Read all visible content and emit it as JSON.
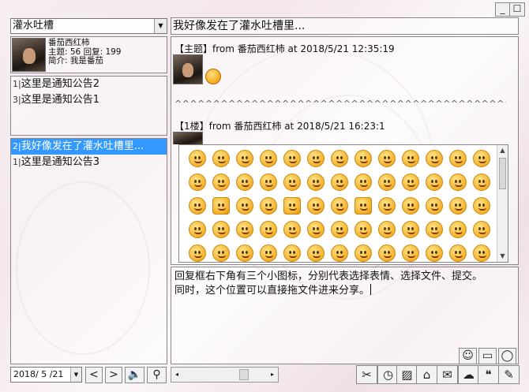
{
  "window": {
    "minimize_glyph": "_",
    "close_glyph": "☐"
  },
  "board_select": {
    "value": "灌水吐槽"
  },
  "thread_title": "我好像发在了灌水吐槽里...",
  "profile": {
    "name": "番茄西红柿",
    "stats": "主题: 56  回复: 199",
    "intro": "简介: 我是番茄"
  },
  "notices": [
    {
      "num": "1",
      "text": "这里是通知公告2"
    },
    {
      "num": "3",
      "text": "这里是通知公告1"
    }
  ],
  "threads": [
    {
      "num": "2",
      "text": "我好像发在了灌水吐槽里...",
      "selected": true
    },
    {
      "num": "1",
      "text": "这里是通知公告3",
      "selected": false
    }
  ],
  "posts": {
    "topic_header": "【主题】from 番茄西红柿 at 2018/5/21 12:35:19",
    "separator": "^^^^^^^^^^^^^^^^^^^^^^^^^^^^^^^^^^^^^^^^^^^^^^^^^^^^^^^^^^^^^^^^^^^^^^^^^^^^^^^^^^",
    "floor_header": "【1楼】from 番茄西红柿 at 2018/5/21 16:23:1"
  },
  "emoji_count": 65,
  "reply": {
    "line1": "回复框右下角有三个小图标，分别代表选择表情、选择文件、提交。",
    "line2": "同时，这个位置可以直接拖文件进来分享。"
  },
  "reply_icons": [
    {
      "name": "emoji-icon",
      "glyph": "☺"
    },
    {
      "name": "folder-icon",
      "glyph": "▭"
    },
    {
      "name": "comment-icon",
      "glyph": "◯"
    }
  ],
  "date_picker": {
    "value": "2018/ 5 /21"
  },
  "nav": {
    "prev": "<",
    "next": ">",
    "sound": "🔈",
    "mic": "⚲"
  },
  "scroll": {
    "left": "◂",
    "right": "▸"
  },
  "toolbar": [
    {
      "name": "scissors-icon",
      "glyph": "✂"
    },
    {
      "name": "clock-icon",
      "glyph": "◷"
    },
    {
      "name": "image-icon",
      "glyph": "▨"
    },
    {
      "name": "home-icon",
      "glyph": "⌂"
    },
    {
      "name": "mail-icon",
      "glyph": "✉"
    },
    {
      "name": "cloud-upload-icon",
      "glyph": "☁"
    },
    {
      "name": "chat-icon",
      "glyph": "❝"
    },
    {
      "name": "edit-icon",
      "glyph": "✎"
    }
  ]
}
